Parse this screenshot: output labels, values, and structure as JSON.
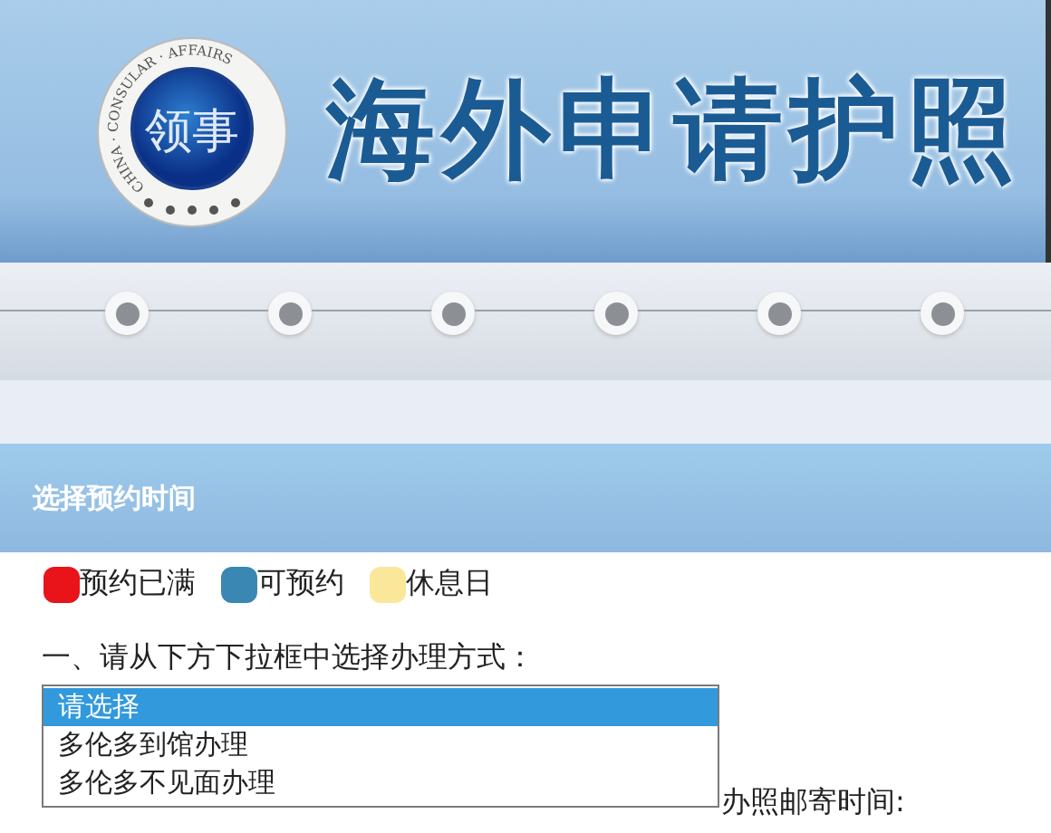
{
  "header": {
    "logo_ring_text": "CHINA · CONSULAR · AFFAIRS",
    "logo_seal": "领事",
    "title": "海外申请护照"
  },
  "section": {
    "title": "选择预约时间"
  },
  "legend": [
    {
      "label": "预约已满",
      "color": "#e8141a"
    },
    {
      "label": "可预约",
      "color": "#3a87b3"
    },
    {
      "label": "休息日",
      "color": "#fbe79a"
    }
  ],
  "question": "一、请从下方下拉框中选择办理方式：",
  "dropdown": {
    "options": [
      {
        "label": "请选择",
        "selected": true
      },
      {
        "label": "多伦多到馆办理",
        "selected": false
      },
      {
        "label": "多伦多不见面办理",
        "selected": false
      }
    ]
  },
  "hidden_text": "办照邮寄时间:"
}
